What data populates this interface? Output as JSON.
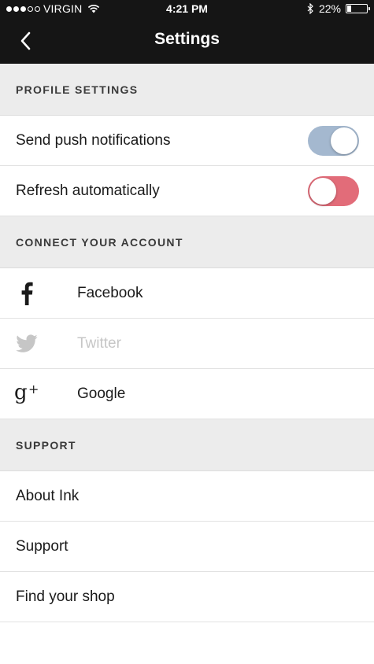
{
  "status_bar": {
    "carrier": "VIRGIN",
    "time": "4:21 PM",
    "battery": "22%",
    "battery_level": 0.22,
    "signal_bars": 3,
    "signal_total": 5
  },
  "nav": {
    "title": "Settings",
    "back_icon": "chevron-left-icon"
  },
  "sections": {
    "profile": {
      "header": "PROFILE SETTINGS",
      "push_label": "Send push notifications",
      "push_on": true,
      "refresh_label": "Refresh automatically",
      "refresh_on": false
    },
    "connect": {
      "header": "CONNECT YOUR ACCOUNT",
      "facebook": "Facebook",
      "twitter": "Twitter",
      "google": "Google"
    },
    "support": {
      "header": "SUPPORT",
      "about": "About Ink",
      "support": "Support",
      "find_shop": "Find your shop"
    }
  },
  "colors": {
    "toggle_on": "#a4b8cf",
    "toggle_off": "#e26c79",
    "disabled_text": "#c6c6c6",
    "bar_background": "#151515",
    "section_background": "#ececec"
  }
}
